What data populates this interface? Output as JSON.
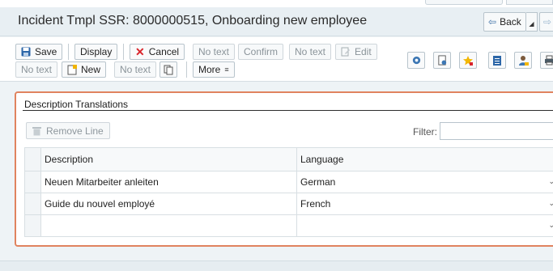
{
  "header": {
    "title": "Incident Tmpl SSR: 8000000515, Onboarding new employee",
    "back_label": "Back"
  },
  "toolbar": {
    "row1": {
      "save": "Save",
      "display": "Display",
      "cancel": "Cancel",
      "no_text_1": "No text",
      "confirm": "Confirm",
      "no_text_2": "No text",
      "edit": "Edit"
    },
    "row2": {
      "no_text_3": "No text",
      "new": "New",
      "no_text_4": "No text",
      "more": "More"
    },
    "icons": [
      "settings-icon",
      "doc-settings-icon",
      "favorite-icon",
      "notes-icon",
      "user-icon",
      "print-icon"
    ]
  },
  "panel": {
    "title": "Description Translations",
    "remove_line": "Remove Line",
    "filter_label": "Filter:",
    "filter_value": "",
    "columns": [
      "Description",
      "Language"
    ],
    "rows": [
      {
        "description": "Neuen Mitarbeiter anleiten",
        "language": "German"
      },
      {
        "description": "Guide du nouvel employé",
        "language": "French"
      },
      {
        "description": "",
        "language": ""
      }
    ]
  },
  "colors": {
    "highlight_border": "#e0835f",
    "cancel_x": "#d9242b"
  }
}
